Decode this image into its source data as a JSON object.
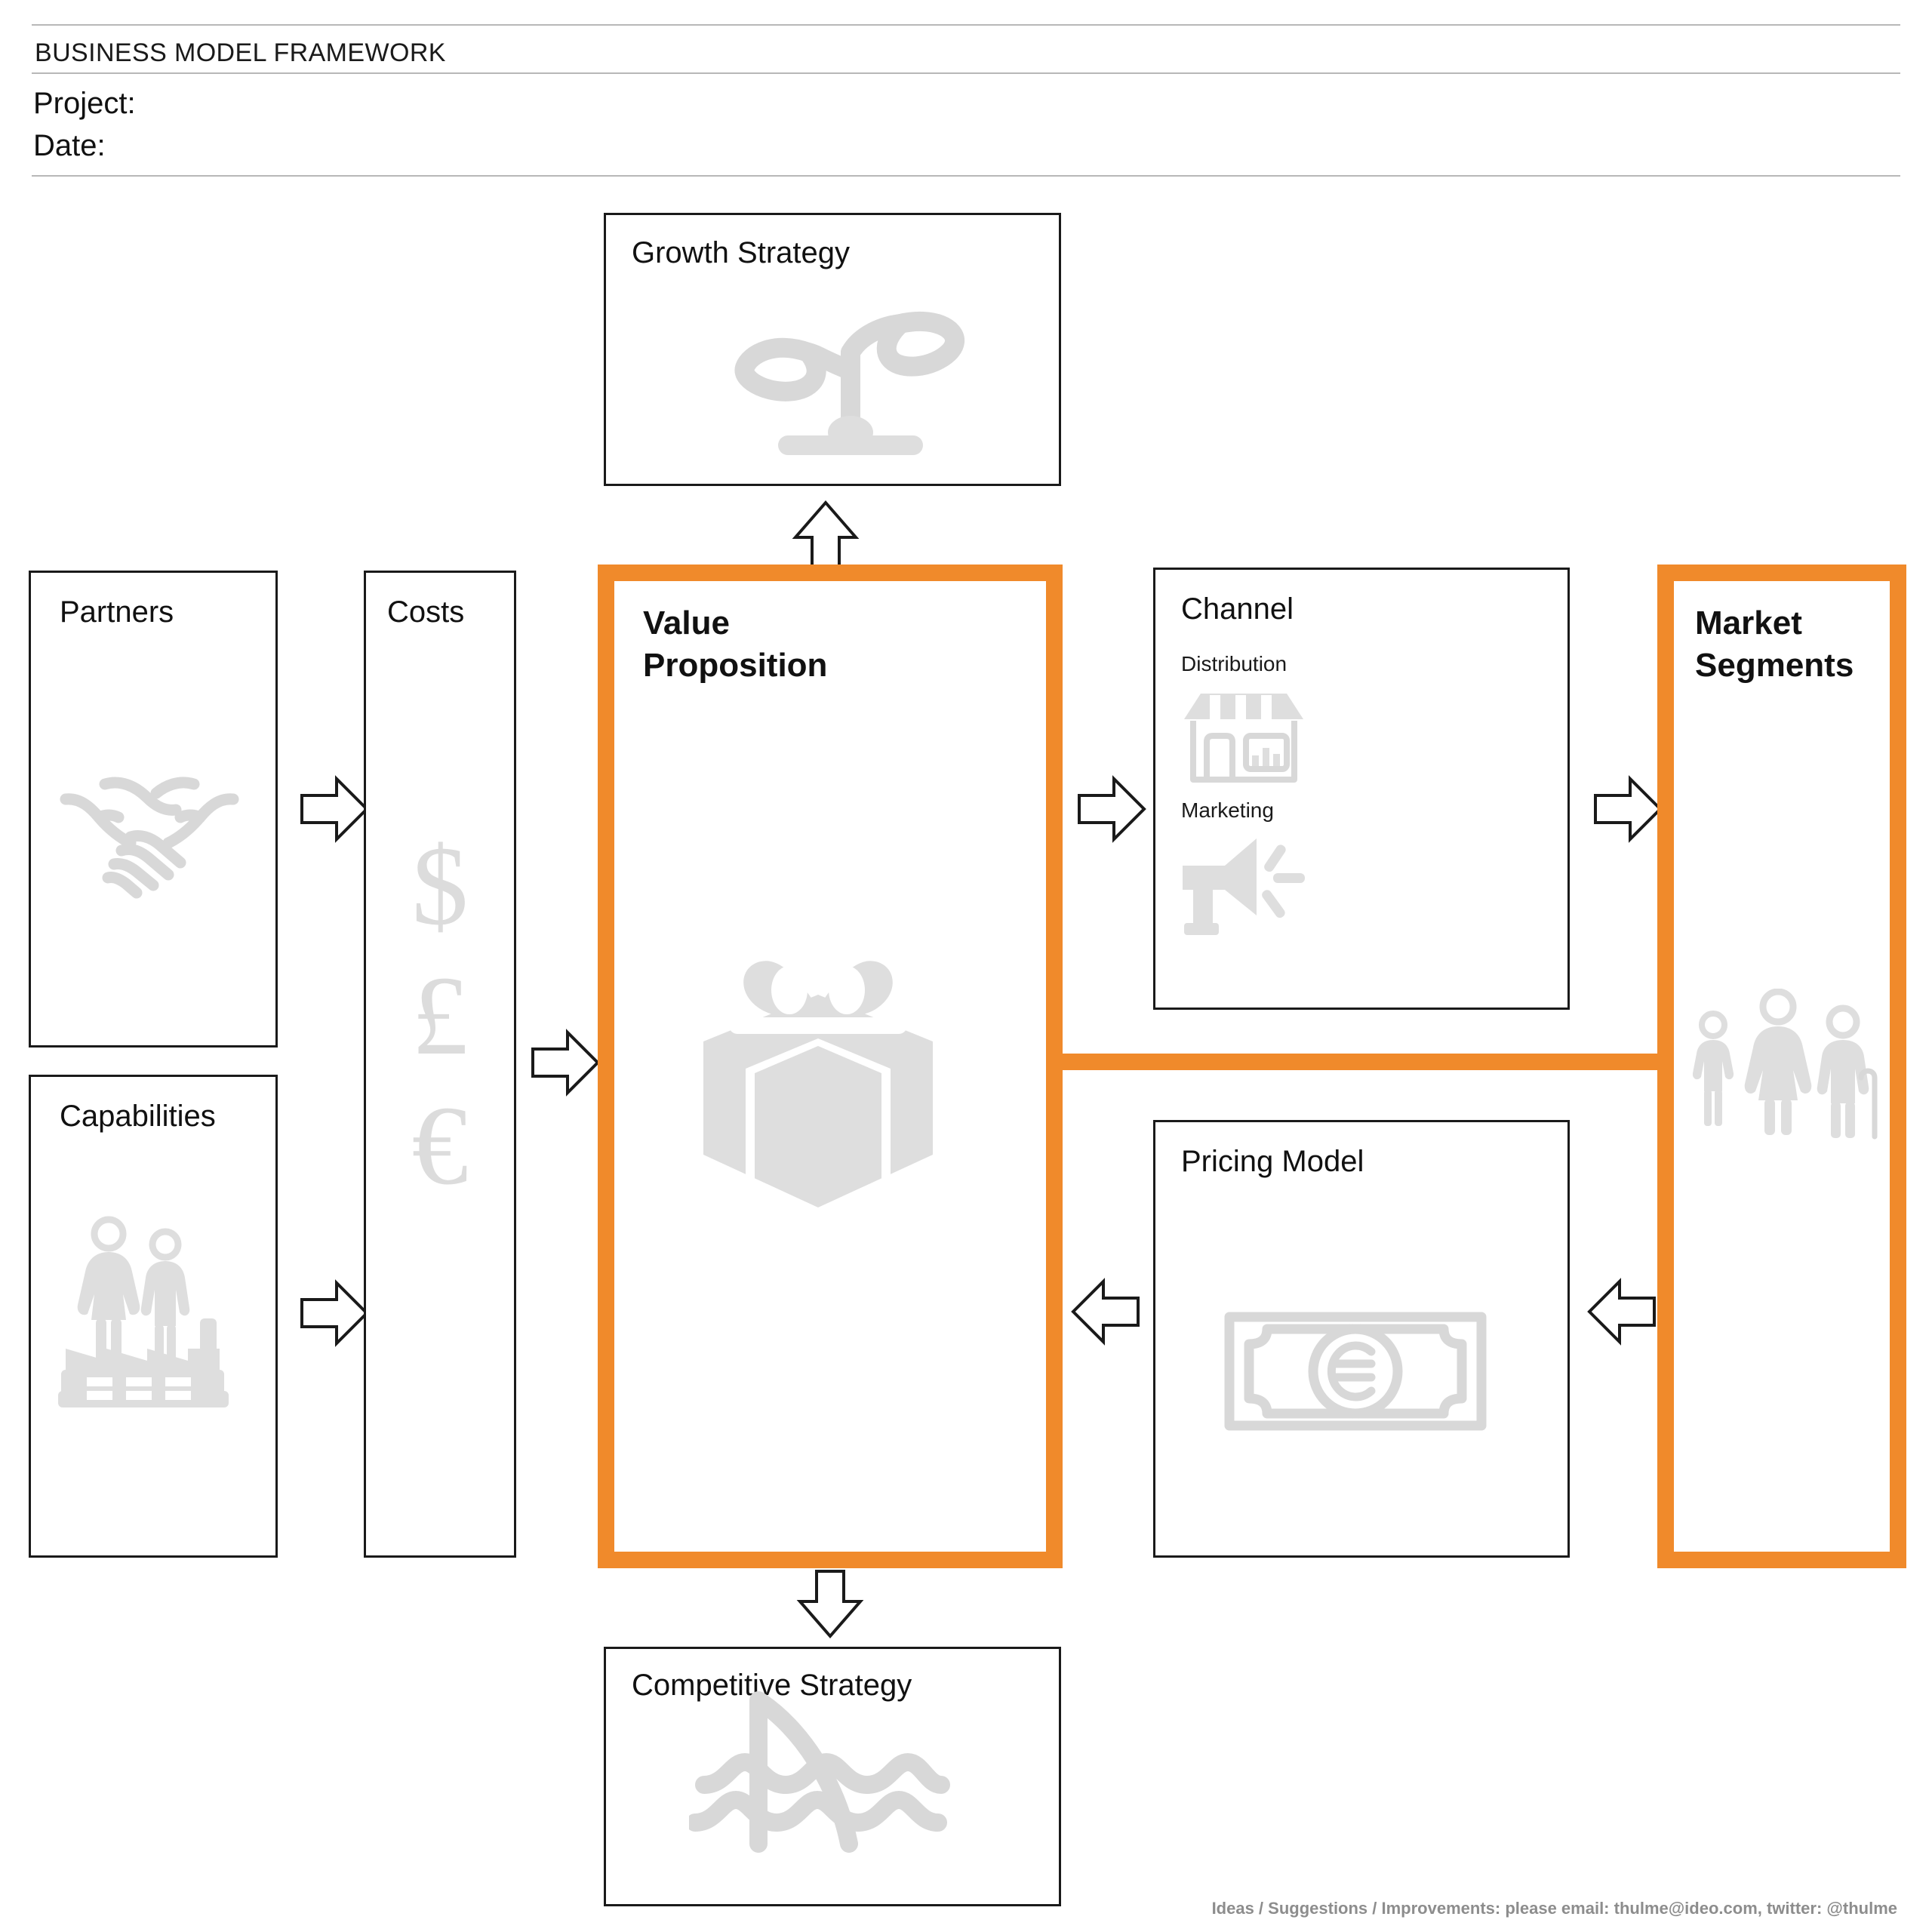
{
  "header": {
    "title": "BUSINESS MODEL FRAMEWORK",
    "project_label": "Project:",
    "date_label": "Date:"
  },
  "footer": {
    "credit": "Ideas / Suggestions / Improvements: please email: thulme@ideo.com, twitter: @thulme"
  },
  "colors": {
    "highlight": "#F08A2B",
    "box_border": "#1a1a1a",
    "icon_gray": "#dedede",
    "rule_gray": "#b8b8b8",
    "footer_gray": "#8d8d8d"
  },
  "blocks": {
    "growth_strategy": {
      "title": "Growth Strategy",
      "icon": "sprout-icon",
      "highlighted": false
    },
    "partners": {
      "title": "Partners",
      "icon": "handshake-icon",
      "highlighted": false
    },
    "capabilities": {
      "title": "Capabilities",
      "icon": "people-factory-icon",
      "highlighted": false
    },
    "costs": {
      "title": "Costs",
      "icon": "currency-symbols-icon",
      "highlighted": false,
      "currencies": [
        "$",
        "£",
        "€"
      ]
    },
    "value_proposition": {
      "title": "Value\nProposition",
      "icon": "gift-box-icon",
      "highlighted": true
    },
    "channel": {
      "title": "Channel",
      "highlighted": false,
      "sub_items": [
        {
          "label": "Distribution",
          "icon": "storefront-icon"
        },
        {
          "label": "Marketing",
          "icon": "megaphone-icon"
        }
      ]
    },
    "pricing_model": {
      "title": "Pricing Model",
      "icon": "banknote-euro-icon",
      "highlighted": false
    },
    "market_segments": {
      "title": "Market\nSegments",
      "icon": "people-group-icon",
      "highlighted": true
    },
    "competitive_strategy": {
      "title": "Competitive Strategy",
      "icon": "shark-fin-waves-icon",
      "highlighted": false
    }
  },
  "connectors": [
    {
      "name": "partners-to-costs",
      "direction": "right"
    },
    {
      "name": "capabilities-to-costs",
      "direction": "right"
    },
    {
      "name": "costs-to-value-proposition",
      "direction": "right"
    },
    {
      "name": "value-proposition-to-growth",
      "direction": "up"
    },
    {
      "name": "value-proposition-to-channel",
      "direction": "right"
    },
    {
      "name": "channel-to-market-segments",
      "direction": "right"
    },
    {
      "name": "market-segments-to-pricing",
      "direction": "left"
    },
    {
      "name": "pricing-to-value-proposition",
      "direction": "left"
    },
    {
      "name": "value-proposition-to-competitive",
      "direction": "down"
    },
    {
      "name": "value-proposition-market-segments-bar",
      "direction": "bar"
    }
  ]
}
